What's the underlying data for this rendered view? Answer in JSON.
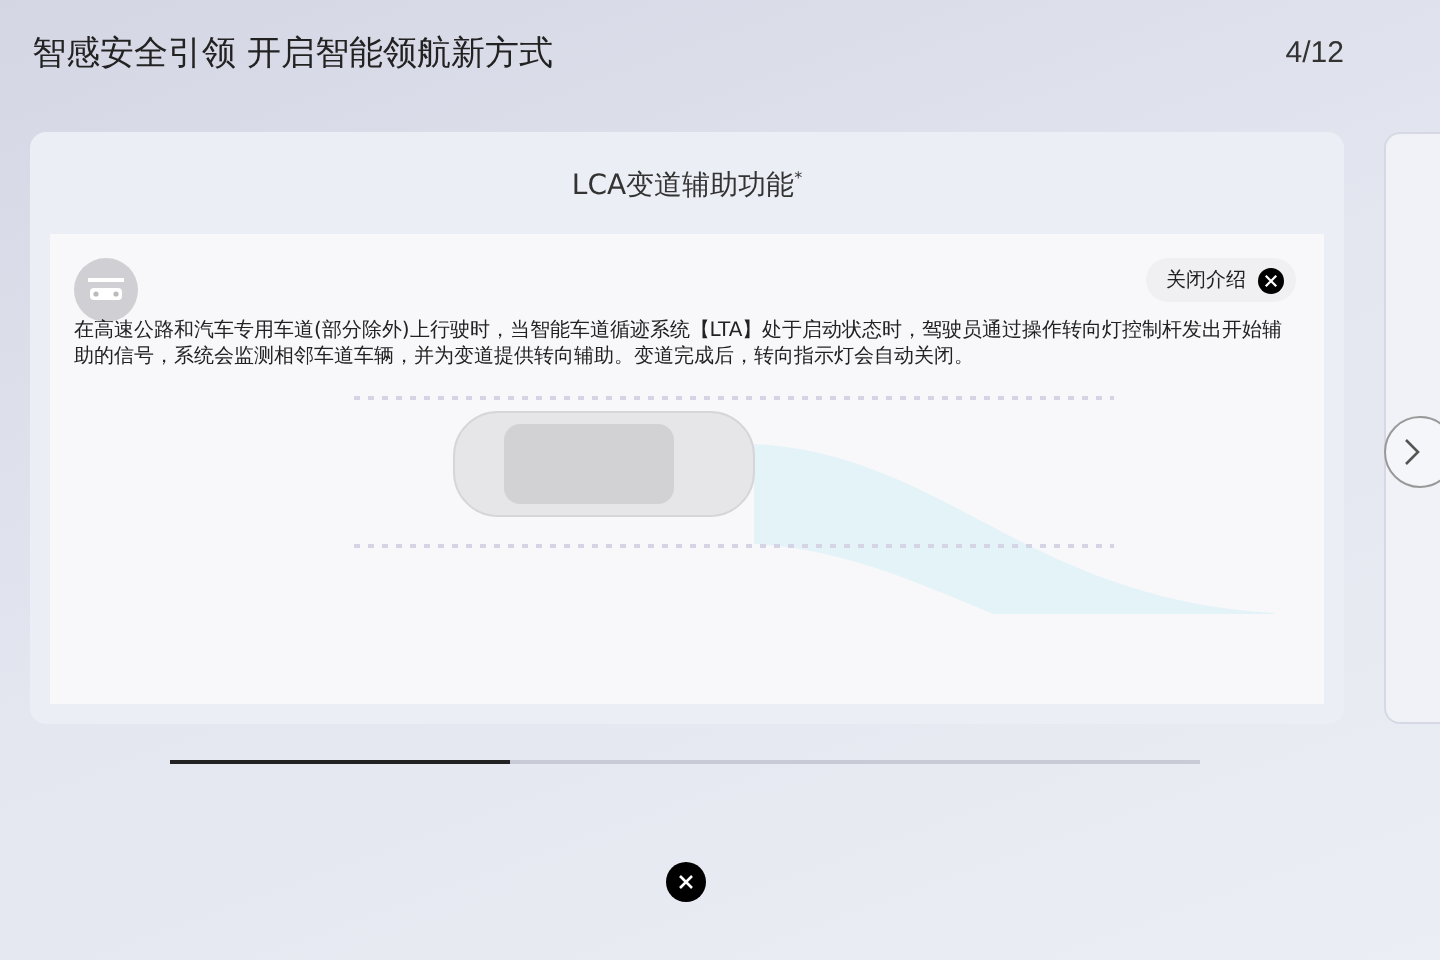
{
  "header": {
    "title": "智感安全引领 开启智能领航新方式",
    "page_counter": "4/12"
  },
  "card": {
    "title": "LCA变道辅助功能$^{*}$",
    "close_intro_label": "关闭介绍",
    "description": "在高速公路和汽车专用车道(部分除外)上行驶时，当智能车道循迹系统【LTA】处于启动状态时，驾驶员通过操作转向灯控制杆发出开始辅助的信号，系统会监测相邻车道车辆，并为变道提供转向辅助。变道完成后，转向指示灯会自动关闭。"
  },
  "progress": {
    "level": 0.33
  }
}
